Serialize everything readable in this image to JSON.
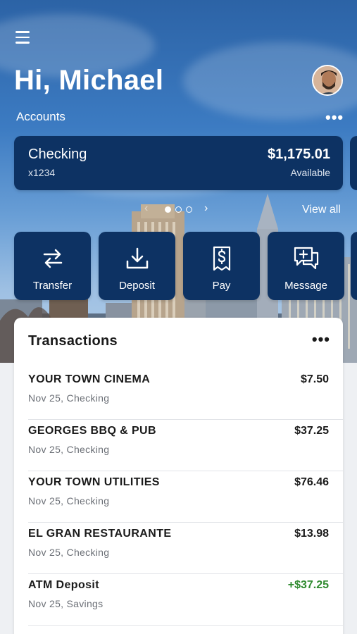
{
  "header": {
    "greeting": "Hi, Michael",
    "menu_icon": "hamburger-menu-icon",
    "avatar_icon": "user-avatar"
  },
  "accounts": {
    "label": "Accounts",
    "more_icon": "more-horizontal-icon",
    "card": {
      "name": "Checking",
      "number": "x1234",
      "balance": "$1,175.01",
      "balance_label": "Available"
    },
    "pager": {
      "total_pages": 3,
      "current_page": 1
    },
    "view_all": "View all"
  },
  "actions": [
    {
      "label": "Transfer",
      "icon": "transfer-arrows-icon"
    },
    {
      "label": "Deposit",
      "icon": "download-deposit-icon"
    },
    {
      "label": "Pay",
      "icon": "receipt-dollar-icon"
    },
    {
      "label": "Message",
      "icon": "chat-plus-icon"
    }
  ],
  "transactions": {
    "title": "Transactions",
    "more_icon": "more-horizontal-icon",
    "items": [
      {
        "name": "YOUR TOWN CINEMA",
        "sub": "Nov 25, Checking",
        "amount": "$7.50",
        "credit": false
      },
      {
        "name": "GEORGES BBQ & PUB",
        "sub": "Nov 25, Checking",
        "amount": "$37.25",
        "credit": false
      },
      {
        "name": "YOUR TOWN UTILITIES",
        "sub": "Nov 25, Checking",
        "amount": "$76.46",
        "credit": false
      },
      {
        "name": "EL GRAN RESTAURANTE",
        "sub": "Nov 25, Checking",
        "amount": "$13.98",
        "credit": false
      },
      {
        "name": "ATM Deposit",
        "sub": "Nov 25, Savings",
        "amount": "+$37.25",
        "credit": true
      }
    ]
  },
  "colors": {
    "card_navy": "#0d3263",
    "credit_green": "#2f8a2f",
    "text_dark": "#1a1a1a",
    "text_muted": "#6b6f76"
  }
}
